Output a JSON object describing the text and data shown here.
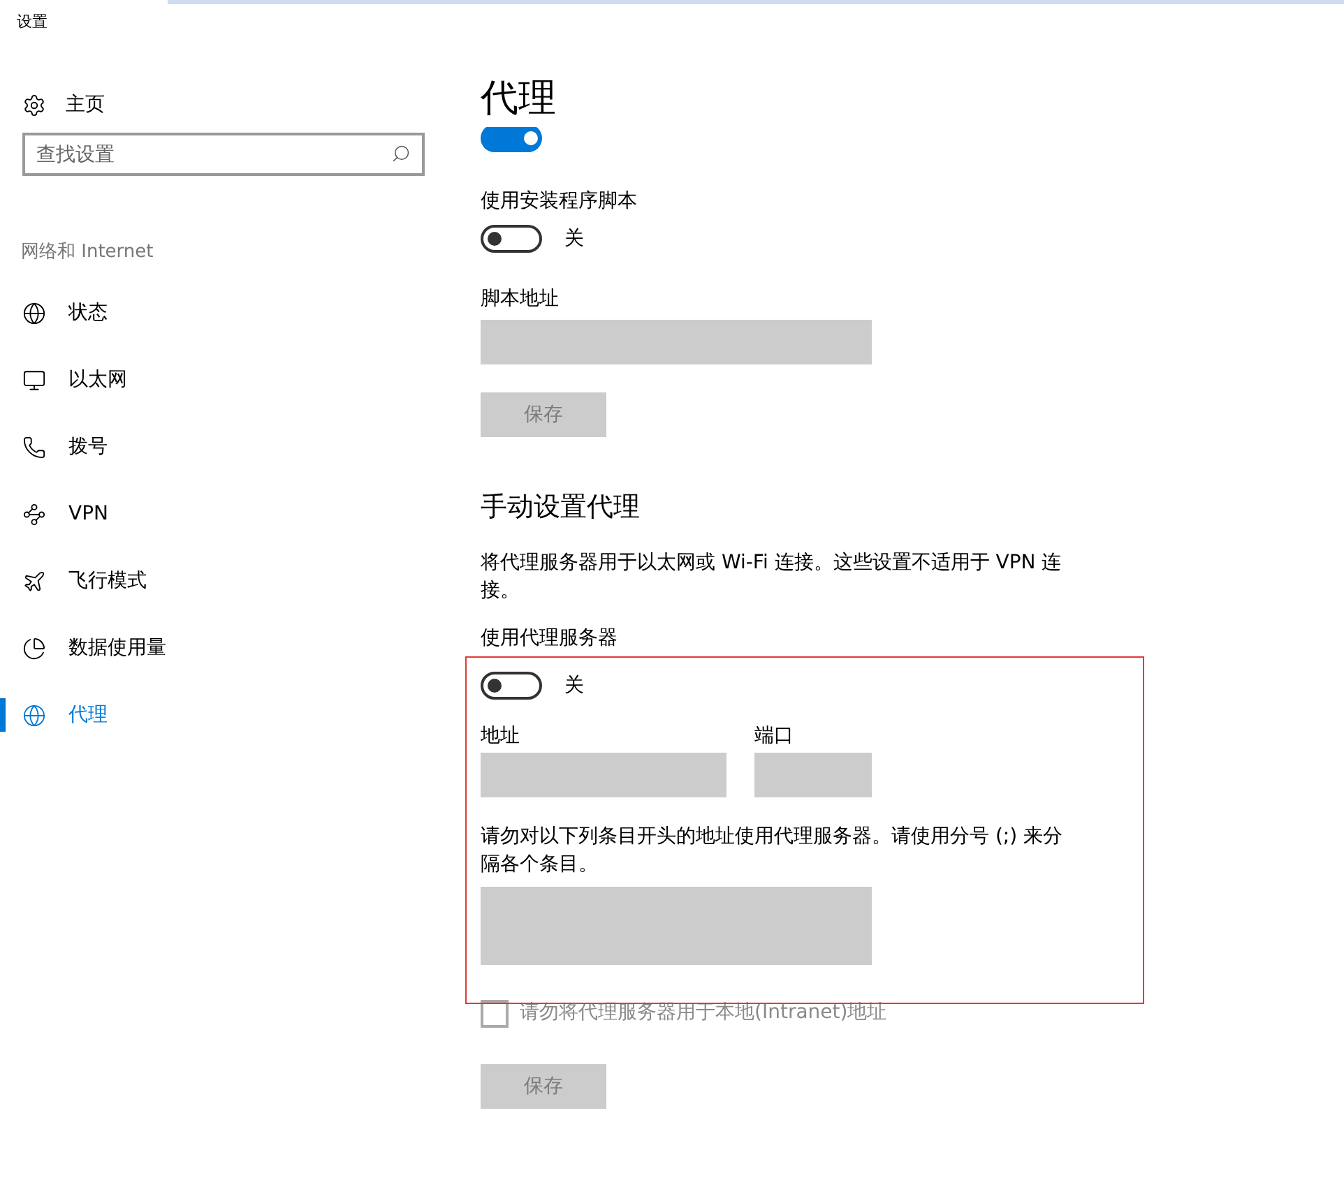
{
  "window": {
    "title": "设置"
  },
  "sidebar": {
    "home": "主页",
    "search": {
      "placeholder": "查找设置"
    },
    "section": "网络和 Internet",
    "items": [
      {
        "label": "状态",
        "selected": false
      },
      {
        "label": "以太网",
        "selected": false
      },
      {
        "label": "拨号",
        "selected": false
      },
      {
        "label": "VPN",
        "selected": false
      },
      {
        "label": "飞行模式",
        "selected": false
      },
      {
        "label": "数据使用量",
        "selected": false
      },
      {
        "label": "代理",
        "selected": true
      }
    ]
  },
  "main": {
    "title": "代理",
    "auto_detect": {
      "on": true
    },
    "script": {
      "label": "使用安装程序脚本",
      "toggle": {
        "on": false,
        "state_label": "关"
      },
      "address_label": "脚本地址",
      "save": {
        "label": "保存",
        "disabled": true
      }
    },
    "manual": {
      "heading": "手动设置代理",
      "description": "将代理服务器用于以太网或 Wi-Fi 连接。这些设置不适用于 VPN 连接。",
      "use_proxy": {
        "label": "使用代理服务器",
        "toggle": {
          "on": false,
          "state_label": "关"
        }
      },
      "address_label": "地址",
      "port_label": "端口",
      "exceptions_label": "请勿对以下列条目开头的地址使用代理服务器。请使用分号 (;) 来分隔各个条目。",
      "local": {
        "label": "请勿将代理服务器用于本地(Intranet)地址",
        "checked": false,
        "disabled": true
      },
      "save": {
        "label": "保存",
        "disabled": true
      }
    }
  },
  "annotation": {
    "kind": "highlight",
    "color": "#e53935"
  }
}
